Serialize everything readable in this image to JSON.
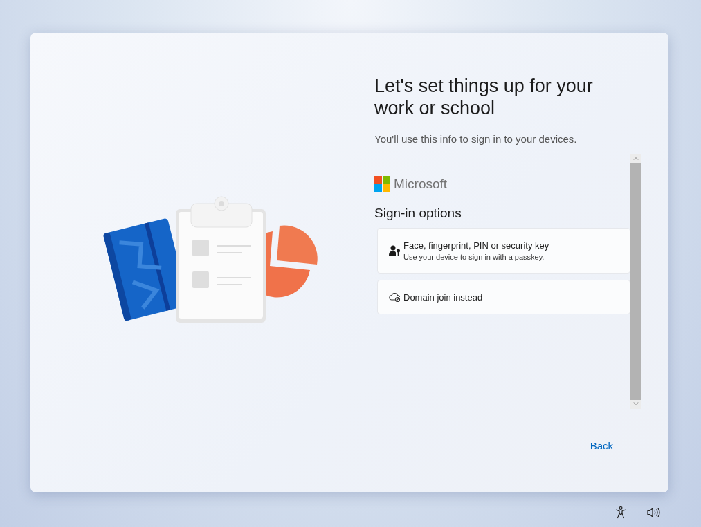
{
  "title": "Let's set things up for your work or school",
  "subtitle": "You'll use this info to sign in to your devices.",
  "brand": "Microsoft",
  "section_title": "Sign-in options",
  "options": [
    {
      "kind": "passkey",
      "title": "Face, fingerprint, PIN or security key",
      "description": "Use your device to sign in with a passkey."
    },
    {
      "kind": "domain",
      "title": "Domain join instead"
    }
  ],
  "back_button": "Back"
}
